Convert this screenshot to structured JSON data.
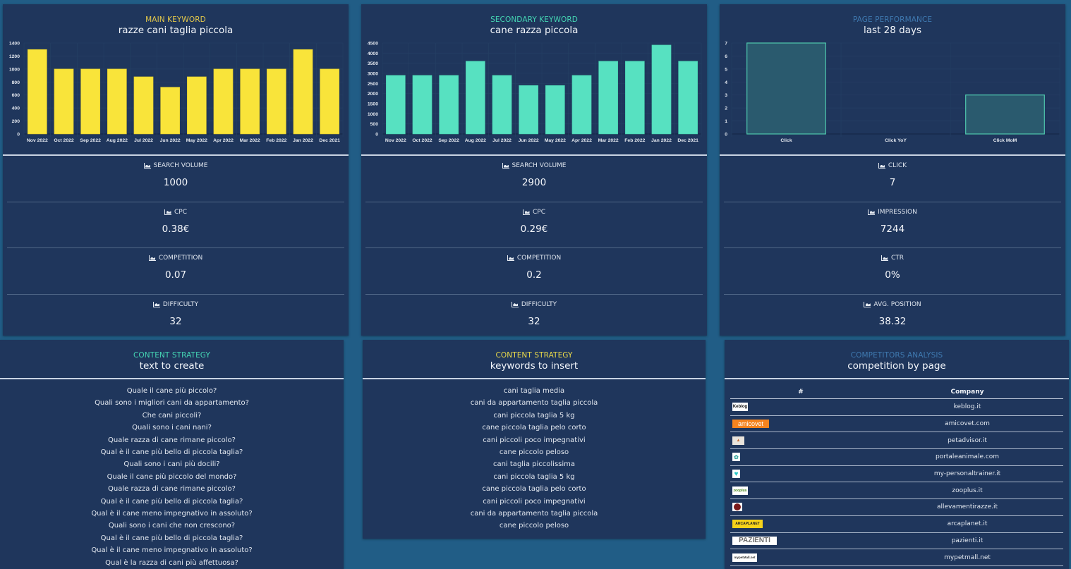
{
  "colors": {
    "page_bg": "#215d86",
    "panel_bg": "#1f365c",
    "yellow": "#f9e43a",
    "teal": "#57e1c1",
    "perf_bar_fill": "#2a5a6e",
    "perf_bar_border": "#4fc7ad",
    "main_kw_color": "#e3c84a",
    "secondary_kw_color": "#45d6b4",
    "page_perf_color": "#3f79b0",
    "content_strategy_1_color": "#45d6b4",
    "content_strategy_2_color": "#e8d84a",
    "competitors_color": "#3f79b0"
  },
  "main_keyword": {
    "subtitle": "MAIN KEYWORD",
    "title": "razze cani taglia piccola",
    "metrics": [
      {
        "label": "SEARCH VOLUME",
        "value": "1000"
      },
      {
        "label": "CPC",
        "value": "0.38€"
      },
      {
        "label": "COMPETITION",
        "value": "0.07"
      },
      {
        "label": "DIFFICULTY",
        "value": "32"
      }
    ]
  },
  "secondary_keyword": {
    "subtitle": "SECONDARY KEYWORD",
    "title": "cane razza piccola",
    "metrics": [
      {
        "label": "SEARCH VOLUME",
        "value": "2900"
      },
      {
        "label": "CPC",
        "value": "0.29€"
      },
      {
        "label": "COMPETITION",
        "value": "0.2"
      },
      {
        "label": "DIFFICULTY",
        "value": "32"
      }
    ]
  },
  "page_performance": {
    "subtitle": "PAGE PERFORMANCE",
    "title": "last 28 days",
    "metrics": [
      {
        "label": "CLICK",
        "value": "7"
      },
      {
        "label": "IMPRESSION",
        "value": "7244"
      },
      {
        "label": "CTR",
        "value": "0%"
      },
      {
        "label": "AVG. POSITION",
        "value": "38.32"
      }
    ]
  },
  "chart_data": [
    {
      "type": "bar",
      "title": "razze cani taglia piccola",
      "categories": [
        "Nov 2022",
        "Oct 2022",
        "Sep 2022",
        "Aug 2022",
        "Jul 2022",
        "Jun 2022",
        "May 2022",
        "Apr 2022",
        "Mar 2022",
        "Feb 2022",
        "Jan 2022",
        "Dec 2021"
      ],
      "values": [
        1300,
        1000,
        1000,
        1000,
        880,
        720,
        880,
        1000,
        1000,
        1000,
        1300,
        1000
      ],
      "yticks": [
        0,
        200,
        400,
        600,
        800,
        1000,
        1200,
        1400
      ],
      "ylim": [
        0,
        1400
      ],
      "xlabel": "",
      "ylabel": "",
      "grid": true,
      "color": "#f9e43a"
    },
    {
      "type": "bar",
      "title": "cane razza piccola",
      "categories": [
        "Nov 2022",
        "Oct 2022",
        "Sep 2022",
        "Aug 2022",
        "Jul 2022",
        "Jun 2022",
        "May 2022",
        "Apr 2022",
        "Mar 2022",
        "Feb 2022",
        "Jan 2022",
        "Dec 2021"
      ],
      "values": [
        2900,
        2900,
        2900,
        3600,
        2900,
        2400,
        2400,
        2900,
        3600,
        3600,
        4400,
        3600
      ],
      "yticks": [
        0,
        500,
        1000,
        1500,
        2000,
        2500,
        3000,
        3500,
        4000,
        4500
      ],
      "ylim": [
        0,
        4500
      ],
      "xlabel": "",
      "ylabel": "",
      "grid": true,
      "color": "#57e1c1"
    },
    {
      "type": "bar",
      "title": "last 28 days",
      "categories": [
        "Click",
        "Click YoY",
        "Click MoM"
      ],
      "values": [
        7,
        0,
        3
      ],
      "yticks": [
        0,
        1,
        2,
        3,
        4,
        5,
        6,
        7
      ],
      "ylim": [
        0,
        7
      ],
      "xlabel": "",
      "ylabel": "",
      "grid": true,
      "color": "#2a5a6e"
    }
  ],
  "content_text": {
    "subtitle": "CONTENT STRATEGY",
    "title": "text to create",
    "items": [
      "Quale il cane più piccolo?",
      "Quali sono i migliori cani da appartamento?",
      "Che cani piccoli?",
      "Quali sono i cani nani?",
      "Quale razza di cane rimane piccolo?",
      "Qual è il cane più bello di piccola taglia?",
      "Quali sono i cani più docili?",
      "Quale il cane più piccolo del mondo?",
      "Quale razza di cane rimane piccolo?",
      "Qual è il cane più bello di piccola taglia?",
      "Qual è il cane meno impegnativo in assoluto?",
      "Quali sono i cani che non crescono?",
      "Qual è il cane più bello di piccola taglia?",
      "Qual è il cane meno impegnativo in assoluto?",
      "Qual è la razza di cani più affettuosa?"
    ]
  },
  "content_keywords": {
    "subtitle": "CONTENT STRATEGY",
    "title": "keywords to insert",
    "items": [
      "cani taglia media",
      "cani da appartamento taglia piccola",
      "cani piccola taglia 5 kg",
      "cane piccola taglia pelo corto",
      "cani piccoli poco impegnativi",
      "cane piccolo peloso",
      "cani taglia piccolissima",
      "cani piccola taglia 5 kg",
      "cane piccola taglia pelo corto",
      "cani piccoli poco impegnativi",
      "cani da appartamento taglia piccola",
      "cane piccolo peloso"
    ]
  },
  "competitors": {
    "subtitle": "COMPETITORS ANALYSIS",
    "title": "competition by page",
    "columns": [
      "#",
      "Company"
    ],
    "rows": [
      {
        "logo_text": "Keblog",
        "logo_icon": "keblog-logo-icon",
        "company": "keblog.it"
      },
      {
        "logo_text": "amicovet",
        "logo_icon": "amicovet-logo-icon",
        "company": "amicovet.com"
      },
      {
        "logo_text": "",
        "logo_icon": "petadvisor-logo-icon",
        "company": "petadvisor.it"
      },
      {
        "logo_text": "",
        "logo_icon": "portaleanimale-logo-icon",
        "company": "portaleanimale.com"
      },
      {
        "logo_text": "",
        "logo_icon": "my-personaltrainer-logo-icon",
        "company": "my-personaltrainer.it"
      },
      {
        "logo_text": "zooplus",
        "logo_icon": "zooplus-logo-icon",
        "company": "zooplus.it"
      },
      {
        "logo_text": "",
        "logo_icon": "allevamentirazze-logo-icon",
        "company": "allevamentirazze.it"
      },
      {
        "logo_text": "ARCAPLANET",
        "logo_icon": "arcaplanet-logo-icon",
        "company": "arcaplanet.it"
      },
      {
        "logo_text": "PAZIENTI",
        "logo_icon": "pazienti-logo-icon",
        "company": "pazienti.it"
      },
      {
        "logo_text": "mypetMall.net",
        "logo_icon": "mypetmall-logo-icon",
        "company": "mypetmall.net"
      }
    ]
  }
}
